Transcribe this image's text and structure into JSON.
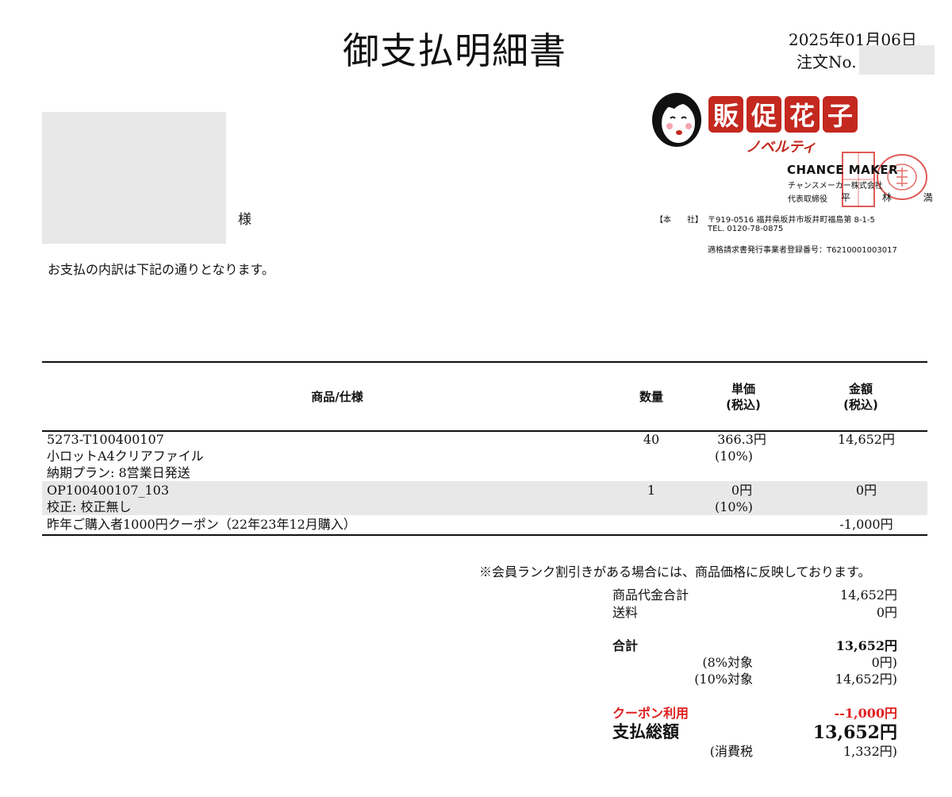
{
  "header": {
    "title": "御支払明細書",
    "date": "2025年01月06日",
    "order_label": "注文No."
  },
  "customer": {
    "honorific": "様",
    "intro": "お支払の内訳は下記の通りとなります。"
  },
  "company": {
    "logo_chars": [
      "販",
      "促",
      "花",
      "子"
    ],
    "logo_sub": "ノベルティ",
    "name_en": "CHANCE MAKER",
    "name_jp": "チャンスメーカー株式会社",
    "rep_title": "代表取締役",
    "rep_name": "平 林 満",
    "address_label": "【本　　社】",
    "address": "〒919-0516 福井県坂井市坂井町福島第 8-1-5",
    "tel": "TEL. 0120-78-0875",
    "registration": "適格請求書発行事業者登録番号：T6210001003017",
    "brand_color": "#c4281f"
  },
  "table": {
    "headers": {
      "product": "商品/仕様",
      "qty": "数量",
      "unit_price_1": "単価",
      "unit_price_2": "(税込)",
      "amount_1": "金額",
      "amount_2": "(税込)"
    },
    "rows": [
      {
        "lines": [
          "5273-T100400107",
          "小ロットA4クリアファイル",
          "納期プラン: 8営業日発送"
        ],
        "qty": "40",
        "unit_price": "366.3円",
        "tax": "(10%)",
        "amount": "14,652円"
      },
      {
        "lines": [
          "OP100400107_103",
          "校正: 校正無し"
        ],
        "qty": "1",
        "unit_price": "0円",
        "tax": "(10%)",
        "amount": "0円"
      },
      {
        "lines": [
          "昨年ご購入者1000円クーポン（22年23年12月購入）"
        ],
        "qty": "",
        "unit_price": "",
        "tax": "",
        "amount": "-1,000円"
      }
    ]
  },
  "summary": {
    "note": "※会員ランク割引きがある場合には、商品価格に反映しております。",
    "subtotal_label": "商品代金合計",
    "subtotal": "14,652円",
    "shipping_label": "送料",
    "shipping": "0円",
    "total_label": "合計",
    "total": "13,652円",
    "tax8_label": "(8%対象",
    "tax8": "0円)",
    "tax10_label": "(10%対象",
    "tax10": "14,652円)",
    "coupon_label": "クーポン利用",
    "coupon": "--1,000円",
    "grand_label": "支払総額",
    "grand": "13,652円",
    "ctax_label": "(消費税",
    "ctax": "1,332円)"
  }
}
